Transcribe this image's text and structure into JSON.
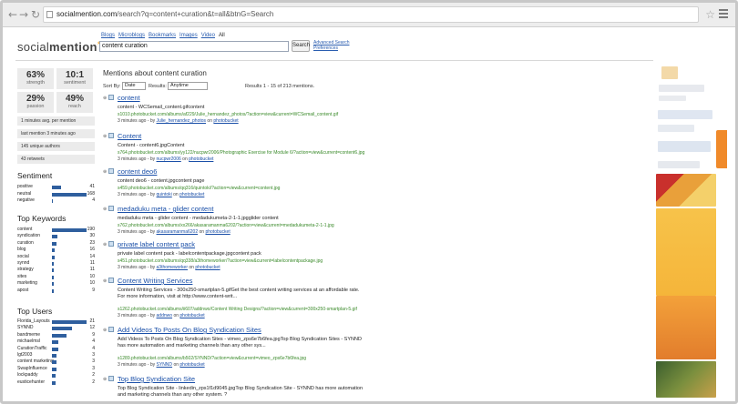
{
  "browser": {
    "url_host": "socialmention.com",
    "url_path": "/search?q=content+curation&t=all&btnG=Search"
  },
  "logo": {
    "part1": "social",
    "part2": "mention",
    "mark": "*"
  },
  "tabs": [
    "Blogs",
    "Microblogs",
    "Bookmarks",
    "Images",
    "Video",
    "All"
  ],
  "search": {
    "value": "content curation",
    "button": "Search",
    "advanced": "Advanced Search",
    "preferences": "Preferences"
  },
  "stats": [
    {
      "value": "63%",
      "label": "strength"
    },
    {
      "value": "10:1",
      "label": "sentiment"
    },
    {
      "value": "29%",
      "label": "passion"
    },
    {
      "value": "49%",
      "label": "reach"
    }
  ],
  "info_pills": [
    "1 minutes avg. per mention",
    "last mention 3 minutes ago",
    "145 unique authors",
    "43 retweets"
  ],
  "sentiment": {
    "heading": "Sentiment",
    "rows": [
      {
        "label": "positive",
        "value": "41",
        "frac": 0.25
      },
      {
        "label": "neutral",
        "value": "168",
        "frac": 1.0
      },
      {
        "label": "negative",
        "value": "4",
        "frac": 0.03
      }
    ]
  },
  "keywords": {
    "heading": "Top Keywords",
    "rows": [
      {
        "label": "content",
        "value": "190",
        "frac": 1.0
      },
      {
        "label": "syndication",
        "value": "30",
        "frac": 0.16
      },
      {
        "label": "curation",
        "value": "23",
        "frac": 0.12
      },
      {
        "label": "blog",
        "value": "16",
        "frac": 0.09
      },
      {
        "label": "social",
        "value": "14",
        "frac": 0.08
      },
      {
        "label": "synnd",
        "value": "11",
        "frac": 0.06
      },
      {
        "label": "strategy",
        "value": "11",
        "frac": 0.06
      },
      {
        "label": "sites",
        "value": "10",
        "frac": 0.05
      },
      {
        "label": "marketing",
        "value": "10",
        "frac": 0.05
      },
      {
        "label": "apost",
        "value": "9",
        "frac": 0.05
      }
    ]
  },
  "users": {
    "heading": "Top Users",
    "rows": [
      {
        "label": "Florida_Layouts",
        "value": "21",
        "frac": 1.0
      },
      {
        "label": "SYNND",
        "value": "12",
        "frac": 0.57
      },
      {
        "label": "bandmeme",
        "value": "9",
        "frac": 0.43
      },
      {
        "label": "michaelmsl",
        "value": "4",
        "frac": 0.19
      },
      {
        "label": "CurationTraffic",
        "value": "4",
        "frac": 0.19
      },
      {
        "label": "lgt2003",
        "value": "3",
        "frac": 0.14
      },
      {
        "label": "content marketing",
        "value": "3",
        "frac": 0.14
      },
      {
        "label": "SwapInfluence",
        "value": "3",
        "frac": 0.14
      },
      {
        "label": "lockpaddy",
        "value": "2",
        "frac": 0.1
      },
      {
        "label": "eusticehunter",
        "value": "2",
        "frac": 0.1
      }
    ]
  },
  "main": {
    "title": "Mentions about content curation",
    "sort_label": "Sort By:",
    "sort_value": "Date",
    "results_label": "Results:",
    "results_value": "Anytime",
    "count": "Results 1 - 15 of 213 mentions."
  },
  "results": [
    {
      "title": "content",
      "desc": "content - WCSemail_content.gifcontent",
      "url": "s1010.photobucket.com/albums/af229/Julie_hernandez_photos/?action=view&current=WCSemail_content.gif",
      "time": "3 minutes ago - by",
      "author": "Julie_hernandez_photos",
      "on": "on",
      "source": "photobucket"
    },
    {
      "title": "Content",
      "desc": "Content - content6.jpgContent",
      "url": "s764.photobucket.com/albums/yy122/nucpwr2006/Photographic Exercise for Module 6/?action=view&current=content6.jpg",
      "time": "3 minutes ago - by",
      "author": "nucpwr2006",
      "on": "on",
      "source": "photobucket"
    },
    {
      "title": "content deo6",
      "desc": "content deo6 - content.jpgcontent page",
      "url": "s459.photobucket.com/albums/qq316/quintoki/?action=view&current=content.jpg",
      "time": "3 minutes ago - by",
      "author": "quintoki",
      "on": "on",
      "source": "photobucket"
    },
    {
      "title": "medaduku meta - glider content",
      "desc": "medaduku meta - glider content - medadukumeta-2-1-1.jpgglider content",
      "url": "s762.photobucket.com/albums/xx266/akasaramanma6202/?action=view&current=medadukumeta-2-1-1.jpg",
      "time": "3 minutes ago - by",
      "author": "akasaramanma6202",
      "on": "on",
      "source": "photobucket"
    },
    {
      "title": "private label content pack",
      "desc": "private label content pack - labelcontentpackage.jpgcontent pack",
      "url": "s451.photobucket.com/albums/qq338/a3thomeworker/?action=view&current=labelcontentpackage.jpg",
      "time": "3 minutes ago - by",
      "author": "a3thomeworker",
      "on": "on",
      "source": "photobucket"
    },
    {
      "title": "Content Writing Services",
      "desc": "Content Writing Services - 300x250-smartplan-5.gifGet the best content writing services at an affordable rate. For more information, visit at http://www.content-writ...",
      "url": "s1262.photobucket.com/albums/ii607/addnwo/Content Writing Designs/?action=view&current=300x250-smartplan-5.gif",
      "time": "3 minutes ago - by",
      "author": "addnwo",
      "on": "on",
      "source": "photobucket"
    },
    {
      "title": "Add Videos To Posts On Blog Syndication Sites",
      "desc": "Add Videos To Posts On Blog Syndication Sites - vimeo_zps6e7b6fea.jpgTop Blog Syndication Sites - SYNND has more automation and marketing channels than any other sys...",
      "url": "s1289.photobucket.com/albums/b502/SYNND/?action=view&current=vimeo_zps6e7b6fea.jpg",
      "time": "3 minutes ago - by",
      "author": "SYNND",
      "on": "on",
      "source": "photobucket"
    },
    {
      "title": "Top Blog Syndication Site",
      "desc": "Top Blog Syndication Site - linkedin_zps1f1d9045.jpgTop Blog Syndication Site - SYNND has more automation and marketing channels than any other system. ?",
      "url": "",
      "time": "",
      "author": "",
      "on": "",
      "source": ""
    }
  ]
}
